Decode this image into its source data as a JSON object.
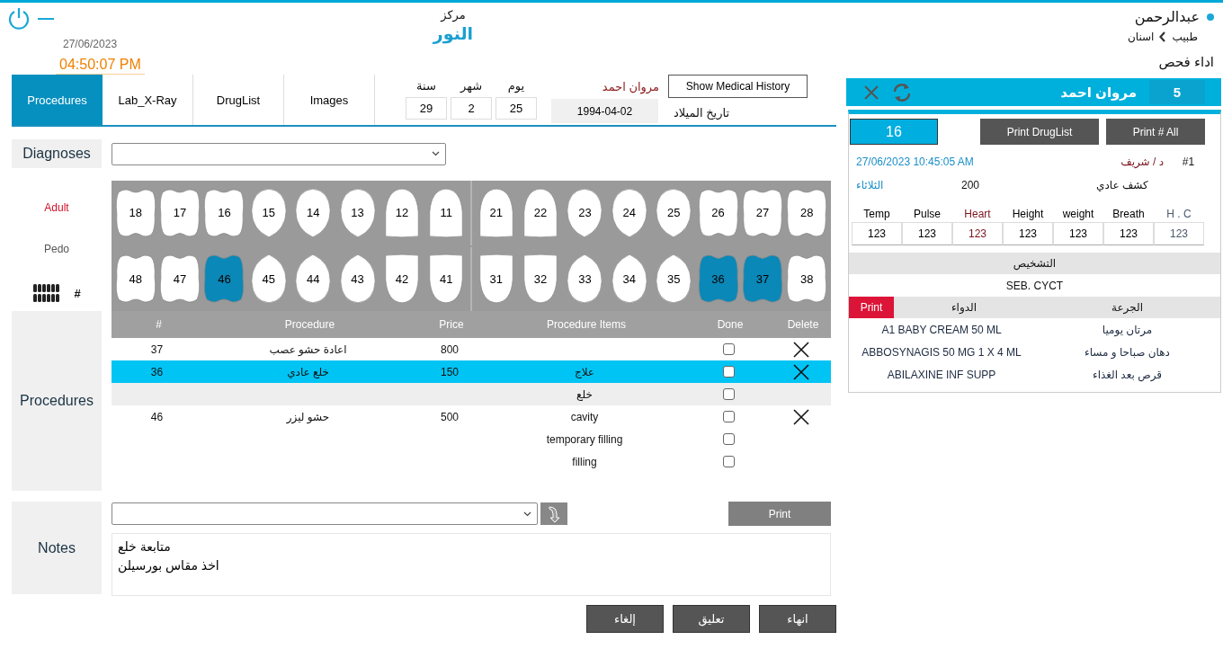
{
  "header": {
    "date": "27/06/2023",
    "time": "04:50:07 PM",
    "center_label": "مركز",
    "center_name": "النور",
    "user": "عبدالرحمن",
    "breadcrumb": [
      "طبيب",
      "اسنان"
    ]
  },
  "tabs": [
    {
      "label": "Images",
      "selected": false
    },
    {
      "label": "DrugList",
      "selected": false
    },
    {
      "label": "Lab_X-Ray",
      "selected": false
    },
    {
      "label": "Procedures",
      "selected": true
    }
  ],
  "age": [
    {
      "label": "يوم",
      "value": "25"
    },
    {
      "label": "شهر",
      "value": "2"
    },
    {
      "label": "سنة",
      "value": "29"
    }
  ],
  "patient": {
    "name": "مروان احمد",
    "history_button": "Show Medical History",
    "birth_date": "1994-04-02",
    "birth_label": "تاريخ الميلاد"
  },
  "diagnoses": {
    "label": "Diagnoses"
  },
  "dentition": [
    {
      "label": "Adult",
      "selected": true
    },
    {
      "label": "Pedo",
      "selected": false
    }
  ],
  "number_toggle": "#",
  "teeth": {
    "upper": [
      {
        "number": "28",
        "kind": "molar",
        "selected": false
      },
      {
        "number": "27",
        "kind": "molar",
        "selected": false
      },
      {
        "number": "26",
        "kind": "molar",
        "selected": false
      },
      {
        "number": "25",
        "kind": "premolar",
        "selected": false
      },
      {
        "number": "24",
        "kind": "premolar",
        "selected": false
      },
      {
        "number": "23",
        "kind": "premolar",
        "selected": false
      },
      {
        "number": "22",
        "kind": "incisor",
        "selected": false
      },
      {
        "number": "21",
        "kind": "incisor",
        "selected": false
      },
      {
        "number": "11",
        "kind": "incisor",
        "selected": false
      },
      {
        "number": "12",
        "kind": "incisor",
        "selected": false
      },
      {
        "number": "13",
        "kind": "premolar",
        "selected": false
      },
      {
        "number": "14",
        "kind": "premolar",
        "selected": false
      },
      {
        "number": "15",
        "kind": "premolar",
        "selected": false
      },
      {
        "number": "16",
        "kind": "molar",
        "selected": false
      },
      {
        "number": "17",
        "kind": "molar",
        "selected": false
      },
      {
        "number": "18",
        "kind": "molar",
        "selected": false
      }
    ],
    "lower": [
      {
        "number": "38",
        "kind": "molar",
        "selected": false
      },
      {
        "number": "37",
        "kind": "molar",
        "selected": true
      },
      {
        "number": "36",
        "kind": "molar",
        "selected": true
      },
      {
        "number": "35",
        "kind": "premolar",
        "selected": false
      },
      {
        "number": "34",
        "kind": "premolar",
        "selected": false
      },
      {
        "number": "33",
        "kind": "premolar",
        "selected": false
      },
      {
        "number": "32",
        "kind": "incisor",
        "selected": false
      },
      {
        "number": "31",
        "kind": "incisor",
        "selected": false
      },
      {
        "number": "41",
        "kind": "incisor",
        "selected": false
      },
      {
        "number": "42",
        "kind": "incisor",
        "selected": false
      },
      {
        "number": "43",
        "kind": "premolar",
        "selected": false
      },
      {
        "number": "44",
        "kind": "premolar",
        "selected": false
      },
      {
        "number": "45",
        "kind": "premolar",
        "selected": false
      },
      {
        "number": "46",
        "kind": "molar",
        "selected": true
      },
      {
        "number": "47",
        "kind": "molar",
        "selected": false
      },
      {
        "number": "48",
        "kind": "molar",
        "selected": false
      }
    ]
  },
  "procedures": {
    "label": "Procedures",
    "columns": [
      "Delete",
      "Done",
      "Procedure Items",
      "Price",
      "Procedure",
      "#"
    ],
    "rows": [
      {
        "tooth": "37",
        "procedure": "اعادة حشو عصب",
        "price": "800",
        "done": false,
        "deletable": true,
        "selected": false,
        "shaded": false
      },
      {
        "tooth": "36",
        "procedure": "خلع عادي",
        "price": "150",
        "item": "علاج",
        "done": false,
        "deletable": true,
        "selected": true,
        "shaded": false
      },
      {
        "item": "خلع",
        "done": false,
        "deletable": false,
        "selected": false,
        "shaded": true
      },
      {
        "tooth": "46",
        "procedure": "حشو ليزر",
        "price": "500",
        "item": "cavity",
        "done": false,
        "deletable": true,
        "selected": false,
        "shaded": false
      },
      {
        "item": "temporary filling",
        "done": false,
        "deletable": false,
        "selected": false,
        "shaded": false
      },
      {
        "item": "filling",
        "done": false,
        "deletable": false,
        "selected": false,
        "shaded": false
      }
    ]
  },
  "notes": {
    "label": "Notes",
    "print_button": "Print",
    "lines": [
      "متابعة خلع",
      "اخذ مقاس بورسيلن"
    ]
  },
  "actions": [
    "انهاء",
    "تعليق",
    "إلغاء"
  ],
  "exam": {
    "title": "اداء فحص",
    "queue_number": "5",
    "patient_name": "مروان احمد",
    "visit_number": "16",
    "print_druglist": "Print DrugList",
    "print_all": "Print # All",
    "datetime": "27/06/2023 10:45:05 AM",
    "doctor": "د / شريف",
    "index": "#1",
    "weekday": "الثلاثاء",
    "fee": "200",
    "visit_type": "كشف عادي",
    "vitals": [
      {
        "label": "H . C",
        "value": "123",
        "color": "#4a5a6a"
      },
      {
        "label": "Breath",
        "value": "123",
        "color": "#000000"
      },
      {
        "label": "weight",
        "value": "123",
        "color": "#000000"
      },
      {
        "label": "Height",
        "value": "123",
        "color": "#000000"
      },
      {
        "label": "Heart",
        "value": "123",
        "color": "#7a1520"
      },
      {
        "label": "Pulse",
        "value": "123",
        "color": "#000000"
      },
      {
        "label": "Temp",
        "value": "123",
        "color": "#000000"
      }
    ],
    "diagnosis_label": "التشخيص",
    "diagnosis": "SEB. CYCT",
    "drug_print": "Print",
    "drug_header": "الدواء",
    "dose_header": "الجرعة",
    "drugs": [
      {
        "drug": "A1 BABY CREAM 50 ML",
        "dose": "مرتان يوميا"
      },
      {
        "drug": "ABBOSYNAGIS 50 MG 1 X 4  ML",
        "dose": "دهان صباحا و مساء"
      },
      {
        "drug": "ABILAXINE INF SUPP",
        "dose": "قرص بعد الغذاء"
      }
    ]
  }
}
